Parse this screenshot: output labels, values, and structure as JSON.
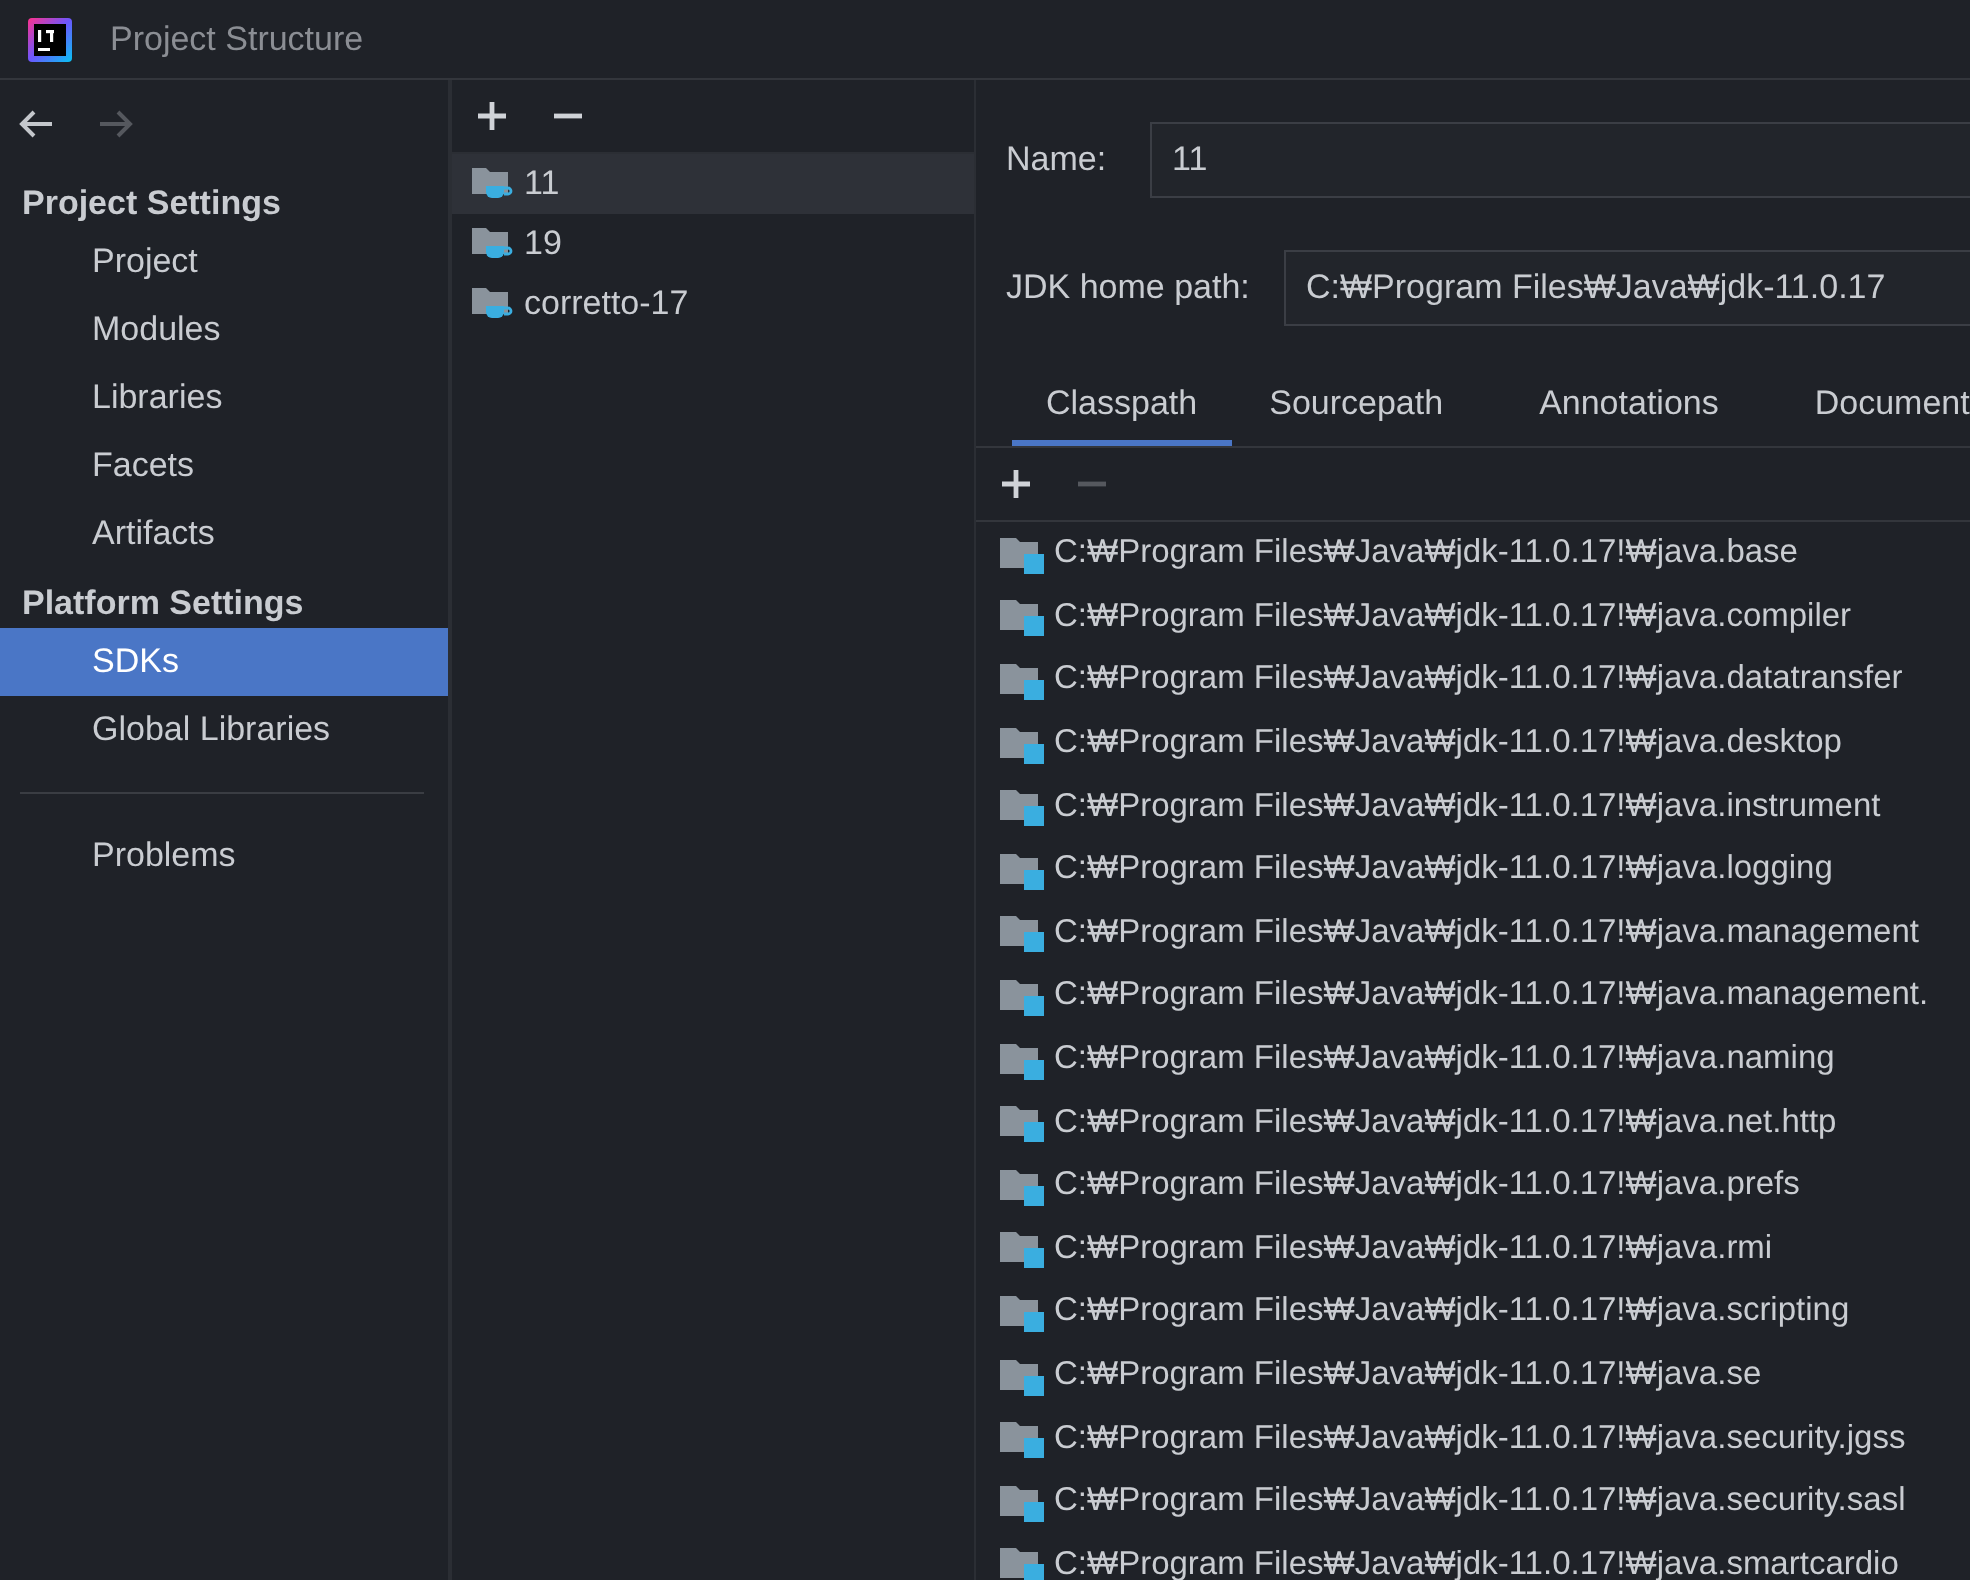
{
  "window": {
    "title": "Project Structure"
  },
  "nav": [
    {
      "kind": "back",
      "disabled": false
    },
    {
      "kind": "forward",
      "disabled": true
    }
  ],
  "sidebar": {
    "sections": [
      {
        "heading": "Project Settings",
        "items": [
          {
            "label": "Project",
            "selected": false
          },
          {
            "label": "Modules",
            "selected": false
          },
          {
            "label": "Libraries",
            "selected": false
          },
          {
            "label": "Facets",
            "selected": false
          },
          {
            "label": "Artifacts",
            "selected": false
          }
        ]
      },
      {
        "heading": "Platform Settings",
        "items": [
          {
            "label": "SDKs",
            "selected": true
          },
          {
            "label": "Global Libraries",
            "selected": false
          }
        ]
      }
    ],
    "extra_items": [
      {
        "label": "Problems",
        "selected": false
      }
    ]
  },
  "sdk_toolbar": [
    {
      "kind": "add",
      "disabled": false
    },
    {
      "kind": "remove",
      "disabled": false
    }
  ],
  "sdks": [
    {
      "name": "11",
      "selected": true
    },
    {
      "name": "19",
      "selected": false
    },
    {
      "name": "corretto-17",
      "selected": false
    }
  ],
  "details": {
    "name_label": "Name:",
    "name": "11",
    "home_label": "JDK home path:",
    "home_path": "C:₩Program Files₩Java₩jdk-11.0.17"
  },
  "tabs": [
    {
      "label": "Classpath",
      "selected": true
    },
    {
      "label": "Sourcepath",
      "selected": false
    },
    {
      "label": "Annotations",
      "selected": false
    },
    {
      "label": "Document",
      "selected": false
    }
  ],
  "classpath_toolbar": [
    {
      "kind": "add",
      "disabled": false
    },
    {
      "kind": "remove",
      "disabled": true
    }
  ],
  "classpath": [
    "C:₩Program Files₩Java₩jdk-11.0.17!₩java.base",
    "C:₩Program Files₩Java₩jdk-11.0.17!₩java.compiler",
    "C:₩Program Files₩Java₩jdk-11.0.17!₩java.datatransfer",
    "C:₩Program Files₩Java₩jdk-11.0.17!₩java.desktop",
    "C:₩Program Files₩Java₩jdk-11.0.17!₩java.instrument",
    "C:₩Program Files₩Java₩jdk-11.0.17!₩java.logging",
    "C:₩Program Files₩Java₩jdk-11.0.17!₩java.management",
    "C:₩Program Files₩Java₩jdk-11.0.17!₩java.management.",
    "C:₩Program Files₩Java₩jdk-11.0.17!₩java.naming",
    "C:₩Program Files₩Java₩jdk-11.0.17!₩java.net.http",
    "C:₩Program Files₩Java₩jdk-11.0.17!₩java.prefs",
    "C:₩Program Files₩Java₩jdk-11.0.17!₩java.rmi",
    "C:₩Program Files₩Java₩jdk-11.0.17!₩java.scripting",
    "C:₩Program Files₩Java₩jdk-11.0.17!₩java.se",
    "C:₩Program Files₩Java₩jdk-11.0.17!₩java.security.jgss",
    "C:₩Program Files₩Java₩jdk-11.0.17!₩java.security.sasl",
    "C:₩Program Files₩Java₩jdk-11.0.17!₩java.smartcardio"
  ]
}
